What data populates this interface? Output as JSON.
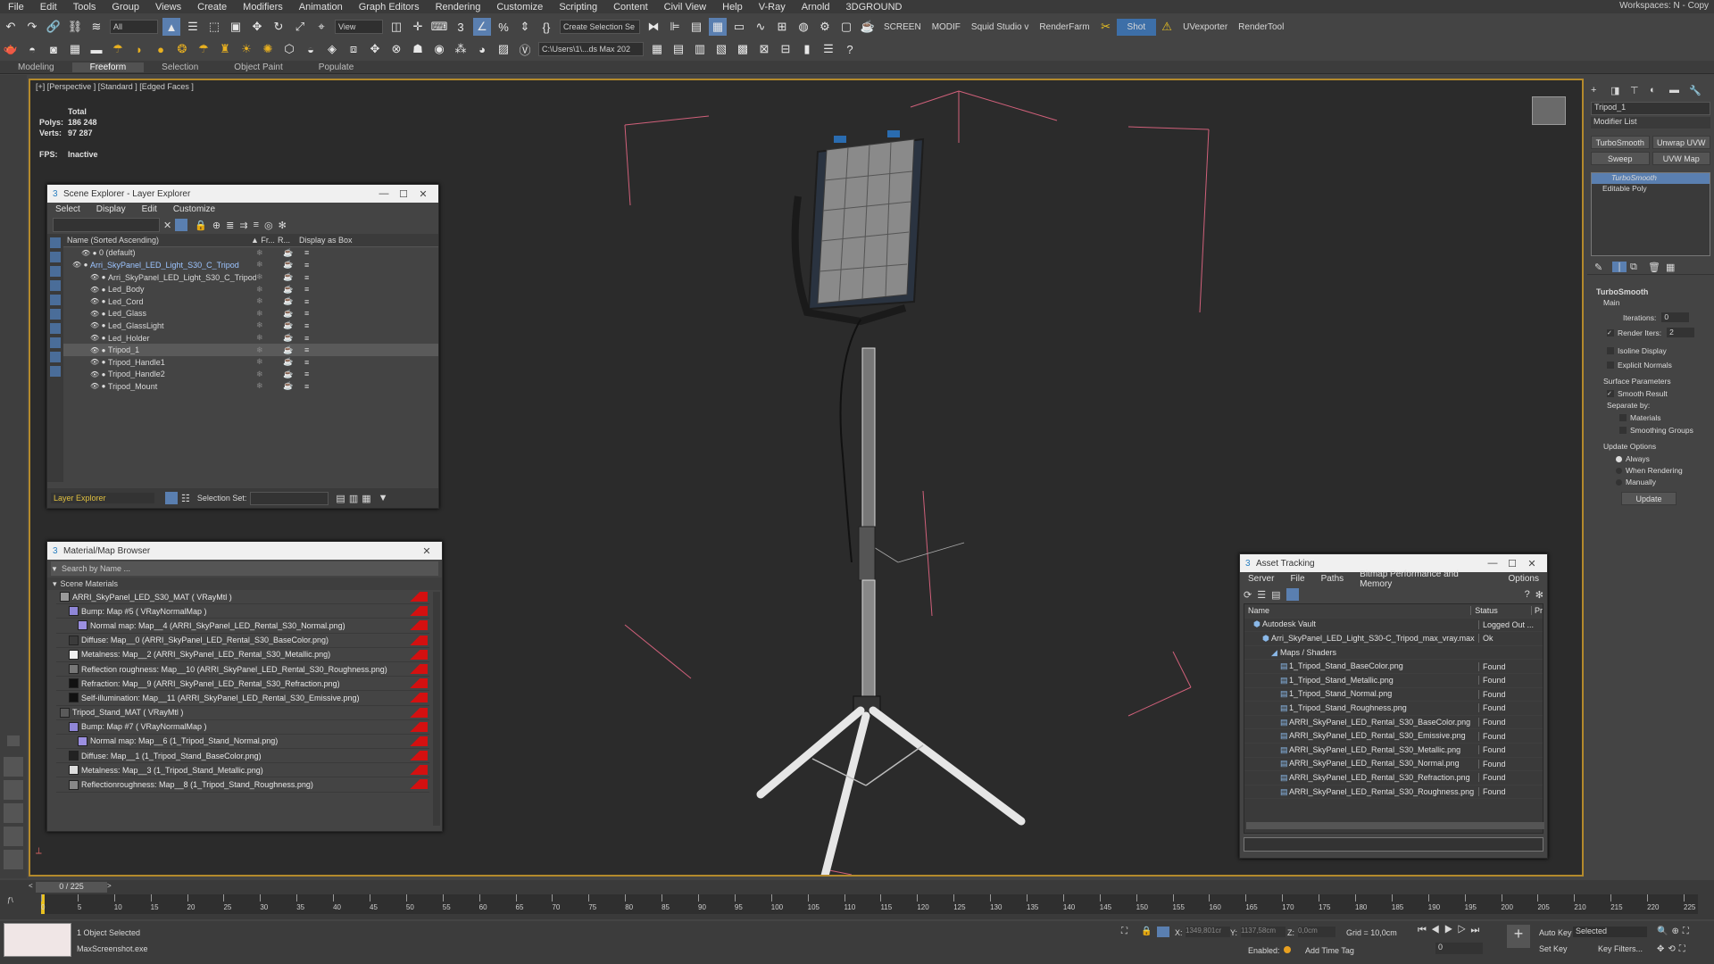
{
  "menu": [
    "File",
    "Edit",
    "Tools",
    "Group",
    "Views",
    "Create",
    "Modifiers",
    "Animation",
    "Graph Editors",
    "Rendering",
    "Customize",
    "Scripting",
    "Content",
    "Civil View",
    "Help",
    "V-Ray",
    "Arnold",
    "3DGROUND"
  ],
  "workspaces": "Workspaces:  N - Copy",
  "toolbar1": {
    "selection_filter": "All",
    "ref_coord": "View",
    "named_selection": "Create Selection Se",
    "screen": "SCREEN",
    "modif": "MODIF",
    "squid": "Squid Studio v",
    "renderfarm": "RenderFarm",
    "shot": "Shot",
    "uvexporter": "UVexporter",
    "rendertool": "RenderTool"
  },
  "toolbar2": {
    "path": "C:\\Users\\1\\...ds Max 202"
  },
  "ribbon_tabs": [
    "Modeling",
    "Freeform",
    "Selection",
    "Object Paint",
    "Populate"
  ],
  "ribbon_active": "Freeform",
  "viewport": {
    "label": "[+] [Perspective ] [Standard ] [Edged Faces ]",
    "total_label": "Total",
    "polys_label": "Polys:",
    "polys_value": "186 248",
    "verts_label": "Verts:",
    "verts_value": "97 287",
    "fps_label": "FPS:",
    "fps_value": "Inactive"
  },
  "scene_explorer": {
    "title": "Scene Explorer - Layer Explorer",
    "menu": [
      "Select",
      "Display",
      "Edit",
      "Customize"
    ],
    "col_name": "Name (Sorted Ascending)",
    "col_fr": "▲ Fr...",
    "col_r": "R...",
    "col_box": "Display as Box",
    "rows": [
      {
        "name": "0 (default)",
        "indent": 2
      },
      {
        "name": "Arri_SkyPanel_LED_Light_S30_C_Tripod",
        "indent": 1,
        "highlight": true
      },
      {
        "name": "Arri_SkyPanel_LED_Light_S30_C_Tripod",
        "indent": 3
      },
      {
        "name": "Led_Body",
        "indent": 3
      },
      {
        "name": "Led_Cord",
        "indent": 3
      },
      {
        "name": "Led_Glass",
        "indent": 3
      },
      {
        "name": "Led_GlassLight",
        "indent": 3
      },
      {
        "name": "Led_Holder",
        "indent": 3
      },
      {
        "name": "Tripod_1",
        "indent": 3,
        "selected": true
      },
      {
        "name": "Tripod_Handle1",
        "indent": 3
      },
      {
        "name": "Tripod_Handle2",
        "indent": 3
      },
      {
        "name": "Tripod_Mount",
        "indent": 3
      }
    ],
    "footer_mode": "Layer Explorer",
    "selection_set_label": "Selection Set:"
  },
  "mat_browser": {
    "title": "Material/Map Browser",
    "search_placeholder": "Search by Name ...",
    "section": "Scene Materials",
    "rows": [
      {
        "text": "ARRI_SkyPanel_LED_S30_MAT  ( VRayMtl )",
        "indent": 0,
        "swatch": "#9a9a9a"
      },
      {
        "text": "Bump: Map #5  ( VRayNormalMap )",
        "indent": 1,
        "swatch": "#8f86d8"
      },
      {
        "text": "Normal map: Map__4 (ARRI_SkyPanel_LED_Rental_S30_Normal.png)",
        "indent": 2,
        "swatch": "#9b8fe0"
      },
      {
        "text": "Diffuse: Map__0 (ARRI_SkyPanel_LED_Rental_S30_BaseColor.png)",
        "indent": 1,
        "swatch": "#3b3b3b"
      },
      {
        "text": "Metalness: Map__2 (ARRI_SkyPanel_LED_Rental_S30_Metallic.png)",
        "indent": 1,
        "swatch": "#eeeeee"
      },
      {
        "text": "Reflection roughness: Map__10 (ARRI_SkyPanel_LED_Rental_S30_Roughness.png)",
        "indent": 1,
        "swatch": "#777777"
      },
      {
        "text": "Refraction: Map__9 (ARRI_SkyPanel_LED_Rental_S30_Refraction.png)",
        "indent": 1,
        "swatch": "#111111"
      },
      {
        "text": "Self-illumination: Map__11 (ARRI_SkyPanel_LED_Rental_S30_Emissive.png)",
        "indent": 1,
        "swatch": "#111111"
      },
      {
        "text": "Tripod_Stand_MAT  ( VRayMtl )",
        "indent": 0,
        "swatch": "#5a5a5a"
      },
      {
        "text": "Bump: Map #7  ( VRayNormalMap )",
        "indent": 1,
        "swatch": "#8f86d8"
      },
      {
        "text": "Normal map: Map__6 (1_Tripod_Stand_Normal.png)",
        "indent": 2,
        "swatch": "#9b8fe0"
      },
      {
        "text": "Diffuse: Map__1 (1_Tripod_Stand_BaseColor.png)",
        "indent": 1,
        "swatch": "#222222"
      },
      {
        "text": "Metalness: Map__3 (1_Tripod_Stand_Metallic.png)",
        "indent": 1,
        "swatch": "#dddddd"
      },
      {
        "text": "Reflectionroughness: Map__8 (1_Tripod_Stand_Roughness.png)",
        "indent": 1,
        "swatch": "#888888"
      }
    ]
  },
  "asset_tracking": {
    "title": "Asset Tracking",
    "menu": [
      "Server",
      "File",
      "Paths",
      "Bitmap Performance and Memory",
      "Options"
    ],
    "col_name": "Name",
    "col_status": "Status",
    "col_pr": "Pr",
    "rows": [
      {
        "name": "Autodesk Vault",
        "status": "Logged Out ...",
        "indent": 1
      },
      {
        "name": "Arri_SkyPanel_LED_Light_S30-C_Tripod_max_vray.max",
        "status": "Ok",
        "indent": 2
      },
      {
        "name": "Maps / Shaders",
        "status": "",
        "indent": 3
      },
      {
        "name": "1_Tripod_Stand_BaseColor.png",
        "status": "Found",
        "indent": 4
      },
      {
        "name": "1_Tripod_Stand_Metallic.png",
        "status": "Found",
        "indent": 4
      },
      {
        "name": "1_Tripod_Stand_Normal.png",
        "status": "Found",
        "indent": 4
      },
      {
        "name": "1_Tripod_Stand_Roughness.png",
        "status": "Found",
        "indent": 4
      },
      {
        "name": "ARRI_SkyPanel_LED_Rental_S30_BaseColor.png",
        "status": "Found",
        "indent": 4
      },
      {
        "name": "ARRI_SkyPanel_LED_Rental_S30_Emissive.png",
        "status": "Found",
        "indent": 4
      },
      {
        "name": "ARRI_SkyPanel_LED_Rental_S30_Metallic.png",
        "status": "Found",
        "indent": 4
      },
      {
        "name": "ARRI_SkyPanel_LED_Rental_S30_Normal.png",
        "status": "Found",
        "indent": 4
      },
      {
        "name": "ARRI_SkyPanel_LED_Rental_S30_Refraction.png",
        "status": "Found",
        "indent": 4
      },
      {
        "name": "ARRI_SkyPanel_LED_Rental_S30_Roughness.png",
        "status": "Found",
        "indent": 4
      }
    ]
  },
  "command_panel": {
    "object_name": "Tripod_1",
    "modifier_list": "Modifier List",
    "btns": [
      "TurboSmooth",
      "Unwrap UVW",
      "Sweep",
      "UVW Map"
    ],
    "stack": [
      "TurboSmooth",
      "Editable Poly"
    ],
    "rollout": "TurboSmooth",
    "main": "Main",
    "iterations_label": "Iterations:",
    "iterations_value": "0",
    "render_iters_label": "Render Iters:",
    "render_iters_value": "2",
    "isoline": "Isoline Display",
    "explicit": "Explicit Normals",
    "surface": "Surface Parameters",
    "smooth_result": "Smooth Result",
    "separate_by": "Separate by:",
    "materials": "Materials",
    "smoothing_groups": "Smoothing Groups",
    "update_options": "Update Options",
    "always": "Always",
    "when_rendering": "When Rendering",
    "manually": "Manually",
    "update_btn": "Update"
  },
  "timeline": {
    "frame_counter": "0 / 225",
    "ticks": [
      "0",
      "5",
      "10",
      "15",
      "20",
      "25",
      "30",
      "35",
      "40",
      "45",
      "50",
      "55",
      "60",
      "65",
      "70",
      "75",
      "80",
      "85",
      "90",
      "95",
      "100",
      "105",
      "110",
      "115",
      "120",
      "125",
      "130",
      "135",
      "140",
      "145",
      "150",
      "155",
      "160",
      "165",
      "170",
      "175",
      "180",
      "185",
      "190",
      "195",
      "200",
      "205",
      "210",
      "215",
      "220",
      "225"
    ]
  },
  "status": {
    "selected": "1 Object Selected",
    "script": "MaxScreenshot.exe",
    "x_label": "X:",
    "x_value": "1349,801cr",
    "y_label": "Y:",
    "y_value": "1137,58cm",
    "z_label": "Z:",
    "z_value": "0,0cm",
    "grid": "Grid = 10,0cm",
    "enabled": "Enabled:",
    "add_time_tag": "Add Time Tag",
    "auto_key": "Auto Key",
    "set_key": "Set Key",
    "selected_dd": "Selected",
    "key_filters": "Key Filters...",
    "frame_field": "0"
  },
  "colors": {
    "accent": "#5a7fb0",
    "viewport_border": "#b48a2c",
    "bbox": "#d0607a"
  }
}
